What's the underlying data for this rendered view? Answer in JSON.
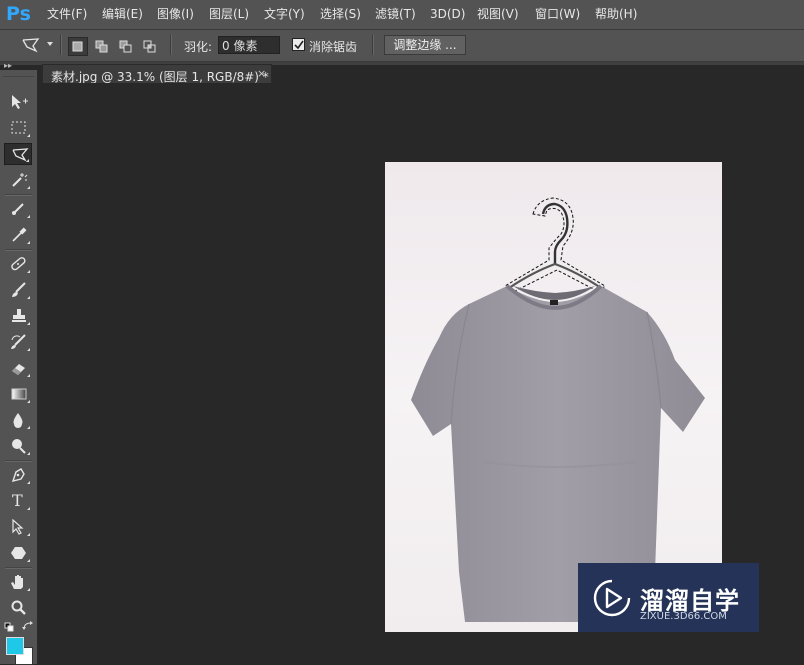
{
  "app": {
    "logo_text": "Ps"
  },
  "menu": [
    {
      "label": "文件(F)"
    },
    {
      "label": "编辑(E)"
    },
    {
      "label": "图像(I)"
    },
    {
      "label": "图层(L)"
    },
    {
      "label": "文字(Y)"
    },
    {
      "label": "选择(S)"
    },
    {
      "label": "滤镜(T)"
    },
    {
      "label": "3D(D)"
    },
    {
      "label": "视图(V)"
    },
    {
      "label": "窗口(W)"
    },
    {
      "label": "帮助(H)"
    }
  ],
  "options": {
    "tool_icon": "polygonal-lasso-icon",
    "selection_modes": [
      "new-selection",
      "add-to-selection",
      "subtract-from-selection",
      "intersect-with-selection"
    ],
    "active_mode": "new-selection",
    "feather_label": "羽化:",
    "feather_value": "0 像素",
    "anti_alias_label": "消除锯齿",
    "anti_alias_checked": true,
    "refine_edge_label": "调整边缘 ..."
  },
  "document": {
    "tab_title": "素材.jpg @ 33.1% (图层 1, RGB/8#) *",
    "close_glyph": "×"
  },
  "tools": [
    "move-tool",
    "rectangular-marquee-tool",
    "polygonal-lasso-tool",
    "magic-wand-tool",
    "crop-tool",
    "eyedropper-tool",
    "spot-healing-tool",
    "brush-tool",
    "clone-stamp-tool",
    "history-brush-tool",
    "eraser-tool",
    "gradient-tool",
    "blur-tool",
    "dodge-tool",
    "pen-tool",
    "type-tool",
    "path-selection-tool",
    "shape-tool",
    "hand-tool",
    "zoom-tool"
  ],
  "active_tool": "polygonal-lasso-tool",
  "type_tool_glyph": "T",
  "colors": {
    "foreground": "#1ec8e6",
    "background": "#ffffff",
    "accent": "#31a8ff"
  },
  "watermark": {
    "title": "溜溜自学",
    "url": "ZIXUE.3D66.COM"
  }
}
